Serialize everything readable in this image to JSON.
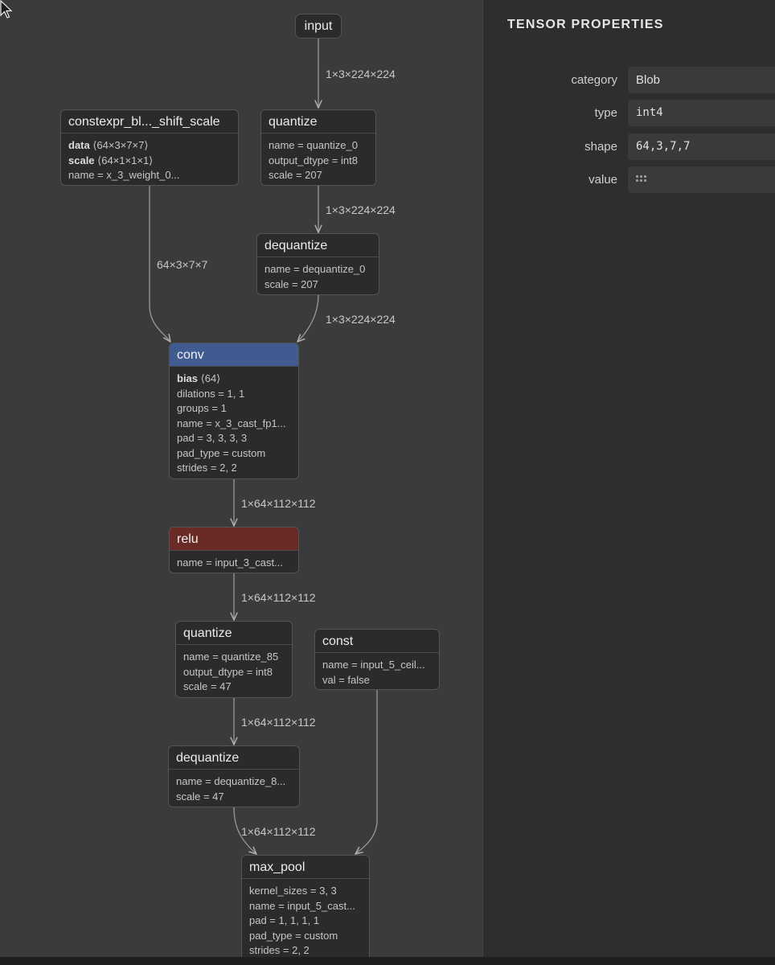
{
  "graph": {
    "nodes": {
      "input": {
        "title": "input"
      },
      "constexpr": {
        "title": "constexpr_bl..._shift_scale",
        "attrs": [
          {
            "key": "data",
            "value": "⟨64×3×7×7⟩"
          },
          {
            "key": "scale",
            "value": "⟨64×1×1×1⟩"
          },
          {
            "text": "name = x_3_weight_0..."
          }
        ]
      },
      "quantize_0": {
        "title": "quantize",
        "attrs": [
          {
            "text": "name = quantize_0"
          },
          {
            "text": "output_dtype = int8"
          },
          {
            "text": "scale = 207"
          }
        ]
      },
      "dequantize_0": {
        "title": "dequantize",
        "attrs": [
          {
            "text": "name = dequantize_0"
          },
          {
            "text": "scale = 207"
          }
        ]
      },
      "conv": {
        "title": "conv",
        "attrs": [
          {
            "key": "bias",
            "value": "⟨64⟩"
          },
          {
            "text": "dilations = 1, 1"
          },
          {
            "text": "groups = 1"
          },
          {
            "text": "name = x_3_cast_fp1..."
          },
          {
            "text": "pad = 3, 3, 3, 3"
          },
          {
            "text": "pad_type = custom"
          },
          {
            "text": "strides = 2, 2"
          }
        ]
      },
      "relu": {
        "title": "relu",
        "attrs": [
          {
            "text": "name = input_3_cast..."
          }
        ]
      },
      "quantize_85": {
        "title": "quantize",
        "attrs": [
          {
            "text": "name = quantize_85"
          },
          {
            "text": "output_dtype = int8"
          },
          {
            "text": "scale = 47"
          }
        ]
      },
      "const": {
        "title": "const",
        "attrs": [
          {
            "text": "name = input_5_ceil..."
          },
          {
            "text": "val = false"
          }
        ]
      },
      "dequantize_8": {
        "title": "dequantize",
        "attrs": [
          {
            "text": "name = dequantize_8..."
          },
          {
            "text": "scale = 47"
          }
        ]
      },
      "max_pool": {
        "title": "max_pool",
        "attrs": [
          {
            "text": "kernel_sizes = 3, 3"
          },
          {
            "text": "name = input_5_cast..."
          },
          {
            "text": "pad = 1, 1, 1, 1"
          },
          {
            "text": "pad_type = custom"
          },
          {
            "text": "strides = 2, 2"
          }
        ]
      }
    },
    "edges": [
      {
        "from": "input",
        "to": "quantize_0",
        "label": "1×3×224×224"
      },
      {
        "from": "quantize_0",
        "to": "dequantize_0",
        "label": "1×3×224×224"
      },
      {
        "from": "constexpr",
        "to": "conv",
        "label": "64×3×7×7"
      },
      {
        "from": "dequantize_0",
        "to": "conv",
        "label": "1×3×224×224"
      },
      {
        "from": "conv",
        "to": "relu",
        "label": "1×64×112×112"
      },
      {
        "from": "relu",
        "to": "quantize_85",
        "label": "1×64×112×112"
      },
      {
        "from": "quantize_85",
        "to": "dequantize_8",
        "label": "1×64×112×112"
      },
      {
        "from": "dequantize_8",
        "to": "max_pool",
        "label": "1×64×112×112"
      },
      {
        "from": "const",
        "to": "max_pool",
        "label": ""
      }
    ]
  },
  "panel": {
    "title": "TENSOR PROPERTIES",
    "properties": [
      {
        "label": "category",
        "value": "Blob"
      },
      {
        "label": "type",
        "value": "int4"
      },
      {
        "label": "shape",
        "value": "64,3,7,7"
      },
      {
        "label": "value",
        "value": "",
        "icon": "grid-icon"
      }
    ]
  }
}
